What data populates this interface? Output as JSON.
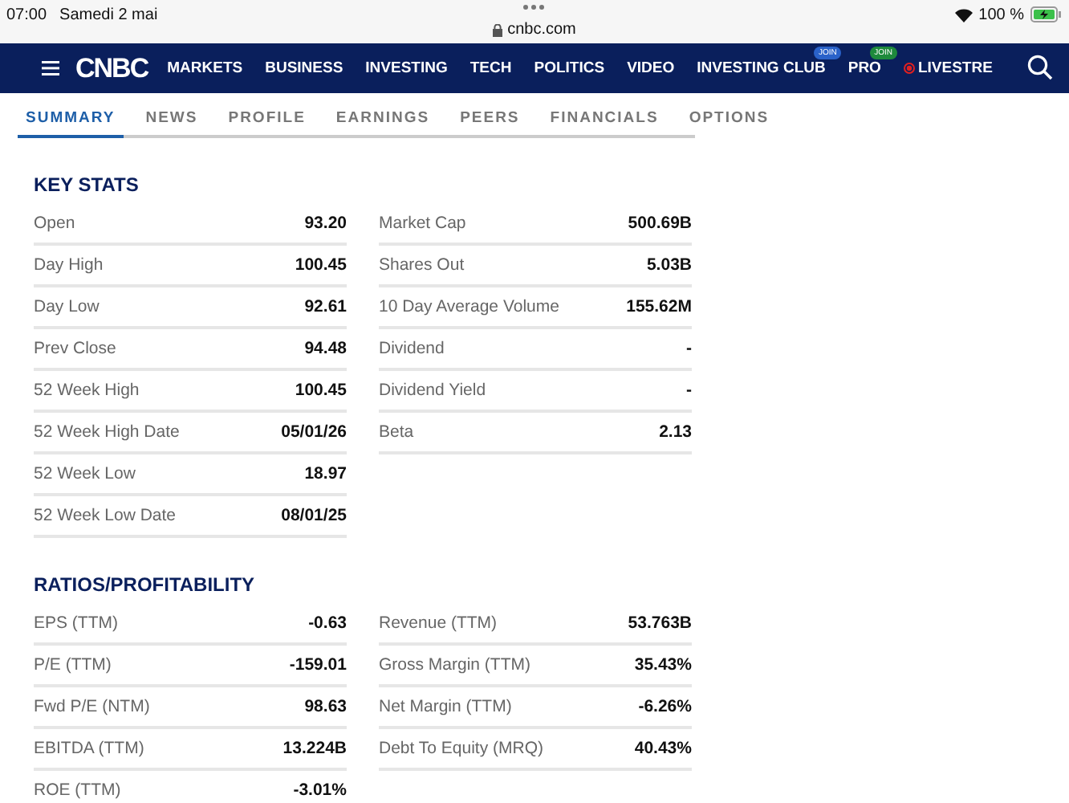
{
  "status_bar": {
    "time": "07:00",
    "date": "Samedi 2 mai",
    "battery": "100 %",
    "charging": true
  },
  "address_bar": {
    "url": "cnbc.com"
  },
  "nav": {
    "logo": "CNBC",
    "items": [
      {
        "label": "MARKETS"
      },
      {
        "label": "BUSINESS"
      },
      {
        "label": "INVESTING"
      },
      {
        "label": "TECH"
      },
      {
        "label": "POLITICS"
      },
      {
        "label": "VIDEO"
      },
      {
        "label": "INVESTING CLUB",
        "badge": "JOIN",
        "color": "#2a62c9"
      },
      {
        "label": "PRO",
        "badge": "JOIN",
        "color": "#1e8a3c"
      },
      {
        "label": "LIVESTRE",
        "kind": "live"
      }
    ]
  },
  "tabs": [
    {
      "label": "SUMMARY",
      "selected": true
    },
    {
      "label": "NEWS",
      "selected": false
    },
    {
      "label": "PROFILE",
      "selected": false
    },
    {
      "label": "EARNINGS",
      "selected": false
    },
    {
      "label": "PEERS",
      "selected": false
    },
    {
      "label": "FINANCIALS",
      "selected": false
    },
    {
      "label": "OPTIONS",
      "selected": false
    }
  ],
  "sections": [
    {
      "title": "KEY STATS",
      "columns": [
        [
          {
            "label": "Open",
            "value": "93.20"
          },
          {
            "label": "Day High",
            "value": "100.45"
          },
          {
            "label": "Day Low",
            "value": "92.61"
          },
          {
            "label": "Prev Close",
            "value": "94.48"
          },
          {
            "label": "52 Week High",
            "value": "100.45"
          },
          {
            "label": "52 Week High Date",
            "value": "05/01/26"
          },
          {
            "label": "52 Week Low",
            "value": "18.97"
          },
          {
            "label": "52 Week Low Date",
            "value": "08/01/25"
          }
        ],
        [
          {
            "label": "Market Cap",
            "value": "500.69B"
          },
          {
            "label": "Shares Out",
            "value": "5.03B"
          },
          {
            "label": "10 Day Average Volume",
            "value": "155.62M"
          },
          {
            "label": "Dividend",
            "value": "-"
          },
          {
            "label": "Dividend Yield",
            "value": "-"
          },
          {
            "label": "Beta",
            "value": "2.13"
          }
        ]
      ]
    },
    {
      "title": "RATIOS/PROFITABILITY",
      "columns": [
        [
          {
            "label": "EPS (TTM)",
            "value": "-0.63"
          },
          {
            "label": "P/E (TTM)",
            "value": "-159.01"
          },
          {
            "label": "Fwd P/E (NTM)",
            "value": "98.63"
          },
          {
            "label": "EBITDA (TTM)",
            "value": "13.224B"
          },
          {
            "label": "ROE (TTM)",
            "value": "-3.01%"
          }
        ],
        [
          {
            "label": "Revenue (TTM)",
            "value": "53.763B"
          },
          {
            "label": "Gross Margin (TTM)",
            "value": "35.43%"
          },
          {
            "label": "Net Margin (TTM)",
            "value": "-6.26%"
          },
          {
            "label": "Debt To Equity (MRQ)",
            "value": "40.43%"
          }
        ]
      ]
    }
  ]
}
